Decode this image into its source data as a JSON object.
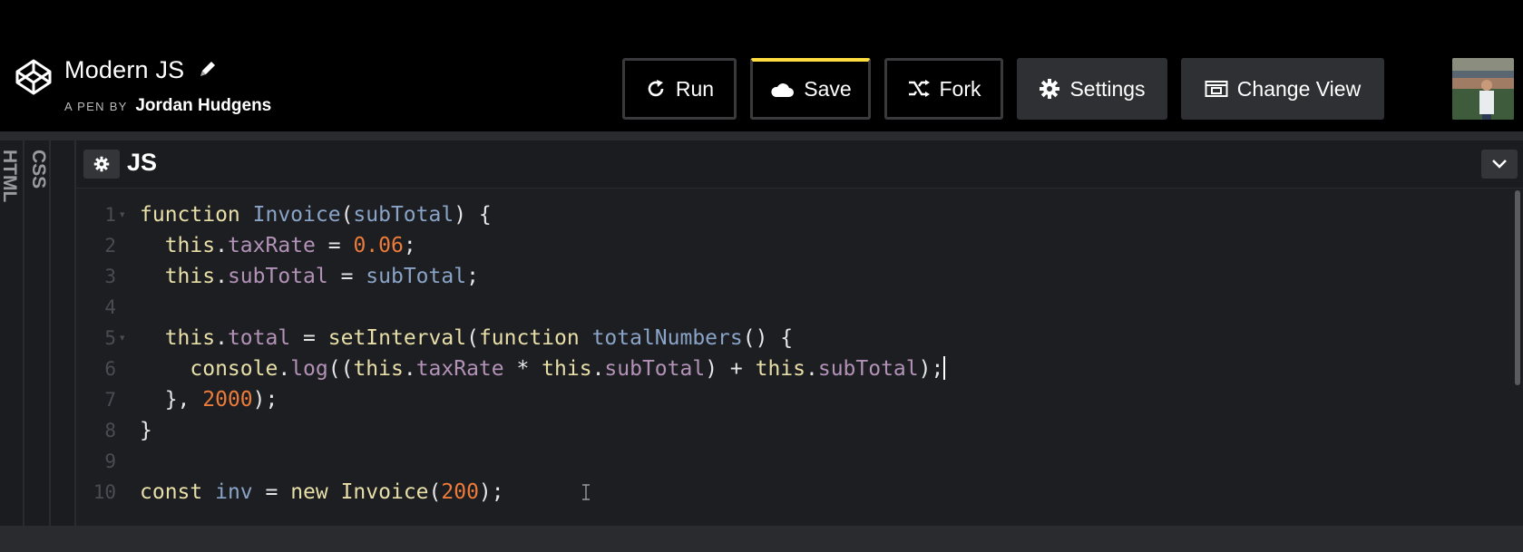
{
  "header": {
    "pen_title": "Modern JS",
    "byline_prefix": "A PEN BY",
    "author": "Jordan Hudgens",
    "buttons": {
      "run": "Run",
      "save": "Save",
      "fork": "Fork",
      "settings": "Settings",
      "change_view": "Change View"
    },
    "accent_color": "#ffdd40"
  },
  "side_tabs": [
    "HTML",
    "CSS"
  ],
  "editor": {
    "language": "JS",
    "line_numbers": [
      "1",
      "2",
      "3",
      "4",
      "5",
      "6",
      "7",
      "8",
      "9",
      "10"
    ],
    "lines": [
      [
        {
          "t": "function ",
          "c": "kw"
        },
        {
          "t": "Invoice",
          "c": "nm"
        },
        {
          "t": "(",
          "c": ""
        },
        {
          "t": "subTotal",
          "c": "nm"
        },
        {
          "t": ") {",
          "c": ""
        }
      ],
      [
        {
          "t": "  this",
          "c": "kw"
        },
        {
          "t": ".",
          "c": ""
        },
        {
          "t": "taxRate",
          "c": "prop"
        },
        {
          "t": " = ",
          "c": ""
        },
        {
          "t": "0.06",
          "c": "num"
        },
        {
          "t": ";",
          "c": ""
        }
      ],
      [
        {
          "t": "  this",
          "c": "kw"
        },
        {
          "t": ".",
          "c": ""
        },
        {
          "t": "subTotal",
          "c": "prop"
        },
        {
          "t": " = ",
          "c": ""
        },
        {
          "t": "subTotal",
          "c": "nm"
        },
        {
          "t": ";",
          "c": ""
        }
      ],
      [],
      [
        {
          "t": "  this",
          "c": "kw"
        },
        {
          "t": ".",
          "c": ""
        },
        {
          "t": "total",
          "c": "prop"
        },
        {
          "t": " = ",
          "c": ""
        },
        {
          "t": "setInterval",
          "c": "fn"
        },
        {
          "t": "(",
          "c": ""
        },
        {
          "t": "function ",
          "c": "kw"
        },
        {
          "t": "totalNumbers",
          "c": "nm"
        },
        {
          "t": "() {",
          "c": ""
        }
      ],
      [
        {
          "t": "    console",
          "c": "fn"
        },
        {
          "t": ".",
          "c": ""
        },
        {
          "t": "log",
          "c": "prop"
        },
        {
          "t": "((",
          "c": ""
        },
        {
          "t": "this",
          "c": "kw"
        },
        {
          "t": ".",
          "c": ""
        },
        {
          "t": "taxRate",
          "c": "prop"
        },
        {
          "t": " * ",
          "c": ""
        },
        {
          "t": "this",
          "c": "kw"
        },
        {
          "t": ".",
          "c": ""
        },
        {
          "t": "subTotal",
          "c": "prop"
        },
        {
          "t": ") + ",
          "c": ""
        },
        {
          "t": "this",
          "c": "kw"
        },
        {
          "t": ".",
          "c": ""
        },
        {
          "t": "subTotal",
          "c": "prop"
        },
        {
          "t": ");",
          "c": ""
        }
      ],
      [
        {
          "t": "  }, ",
          "c": ""
        },
        {
          "t": "2000",
          "c": "num"
        },
        {
          "t": ");",
          "c": ""
        }
      ],
      [
        {
          "t": "}",
          "c": ""
        }
      ],
      [],
      [
        {
          "t": "const ",
          "c": "kw"
        },
        {
          "t": "inv",
          "c": "nm"
        },
        {
          "t": " = ",
          "c": ""
        },
        {
          "t": "new ",
          "c": "kw"
        },
        {
          "t": "Invoice",
          "c": "fn"
        },
        {
          "t": "(",
          "c": ""
        },
        {
          "t": "200",
          "c": "num"
        },
        {
          "t": ");",
          "c": ""
        }
      ]
    ],
    "syntax_colors": {
      "keyword": "#e8dfa8",
      "name": "#8aa4c8",
      "property": "#b392b7",
      "number": "#ed7c3a"
    }
  }
}
